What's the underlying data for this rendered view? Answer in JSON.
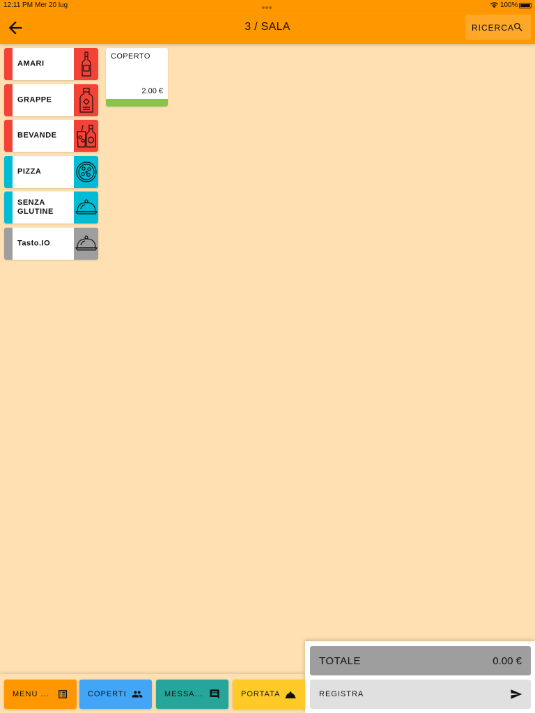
{
  "status_bar": {
    "time": "12:11 PM",
    "date": "Mer 20 lug",
    "battery": "100%"
  },
  "header": {
    "title": "3 / SALA",
    "search_label": "RICERCA",
    "color": "#ff9800"
  },
  "categories": [
    {
      "label": "AMARI",
      "color": "#f44336",
      "icon": "liquor-bottle-icon"
    },
    {
      "label": "GRAPPE",
      "color": "#f44336",
      "icon": "grappa-bottle-icon"
    },
    {
      "label": "BEVANDE",
      "color": "#f44336",
      "icon": "drinks-icon"
    },
    {
      "label": "PIZZA",
      "color": "#00bcd4",
      "icon": "pizza-icon"
    },
    {
      "label": "SENZA GLUTINE",
      "color": "#00bcd4",
      "icon": "cloche-icon"
    },
    {
      "label": "Tasto.IO",
      "color": "#9e9e9e",
      "icon": "cloche-icon"
    }
  ],
  "products": [
    {
      "name": "COPERTO",
      "price": "2.00 €",
      "color": "#8bc34a"
    }
  ],
  "bottom_buttons": [
    {
      "label": "MENU ...",
      "color": "#ff9800",
      "icon": "menu-list-icon"
    },
    {
      "label": "COPERTI",
      "color": "#42a5f5",
      "icon": "people-icon"
    },
    {
      "label": "MESSA...",
      "color": "#26a69a",
      "icon": "message-icon"
    },
    {
      "label": "PORTATA",
      "color": "#ffca28",
      "icon": "serving-dish-icon"
    }
  ],
  "total": {
    "label": "TOTALE",
    "value": "0.00 €"
  },
  "register": {
    "label": "REGISTRA",
    "icon": "send-icon"
  }
}
